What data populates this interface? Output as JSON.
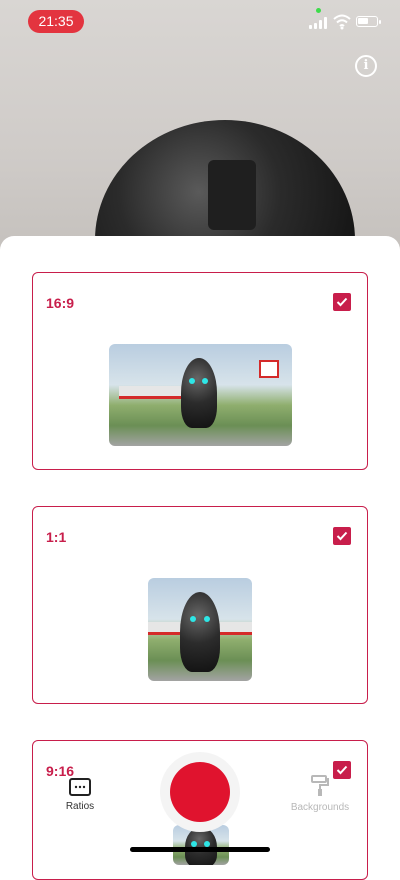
{
  "status_bar": {
    "time": "21:35"
  },
  "camera": {
    "info_symbol": "i"
  },
  "ratios": [
    {
      "label": "16:9",
      "checked": true
    },
    {
      "label": "1:1",
      "checked": true
    },
    {
      "label": "9:16",
      "checked": true
    }
  ],
  "bottom_bar": {
    "ratios_label": "Ratios",
    "backgrounds_label": "Backgrounds",
    "ratios_icon": "aspect-ratio-icon",
    "backgrounds_icon": "paint-roller-icon",
    "record_icon": "record-button"
  },
  "colors": {
    "accent": "#c81e4b",
    "record": "#e0132e",
    "time_pill": "#e3343f"
  }
}
